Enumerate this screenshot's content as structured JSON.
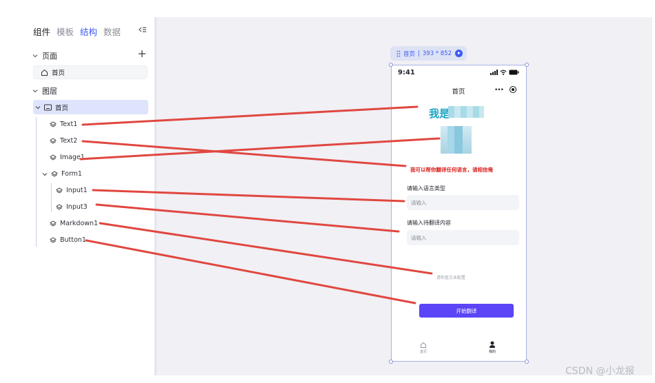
{
  "panel": {
    "tabs": [
      "组件",
      "模板",
      "结构",
      "数据"
    ],
    "pages_section": "页面",
    "page_item": "首页",
    "layers_section": "图层",
    "layer_root": "首页",
    "layers": [
      "Text1",
      "Text2",
      "Image1",
      "Form1",
      "Input1",
      "Input3",
      "Markdown1",
      "Button1"
    ]
  },
  "device": {
    "label_page": "首页",
    "label_size": "393 * 852"
  },
  "phone": {
    "time": "9:41",
    "nav_title": "首页",
    "nav_more": "•••",
    "hero_text": "我是",
    "subtitle": "我可以帮你翻译任何语言，请相信俺",
    "field1_label": "请输入语言类型",
    "field1_placeholder": "请输入",
    "field2_label": "请输入待翻译内容",
    "field2_placeholder": "请输入",
    "markdown_text": "请检查文本配置",
    "button_label": "开始翻译",
    "tab_home": "首页",
    "tab_mine": "我的"
  },
  "colors": {
    "accent": "#3d5bf6",
    "button": "#5b45f6",
    "connector": "#e0473f",
    "hero": "#1aa3c2",
    "subtitle": "#d8231f"
  },
  "watermark": "CSDN @小龙报"
}
